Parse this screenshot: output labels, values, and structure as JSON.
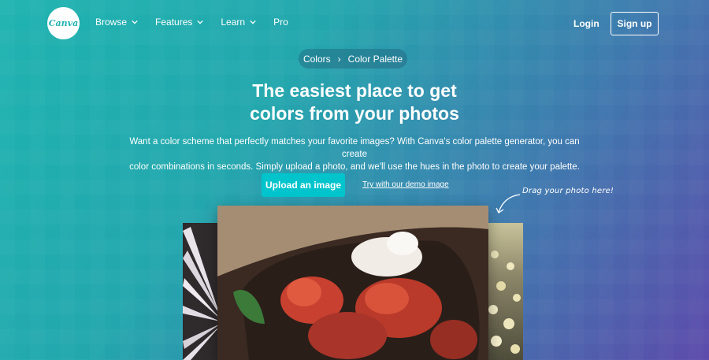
{
  "header": {
    "logo_text": "Canva",
    "nav": [
      {
        "label": "Browse",
        "has_dropdown": true
      },
      {
        "label": "Features",
        "has_dropdown": true
      },
      {
        "label": "Learn",
        "has_dropdown": true
      },
      {
        "label": "Pro",
        "has_dropdown": false
      }
    ],
    "login_label": "Login",
    "signup_label": "Sign up"
  },
  "breadcrumb": {
    "parent": "Colors",
    "current": "Color Palette"
  },
  "hero": {
    "title_line1": "The easiest place to get",
    "title_line2": "colors from your photos",
    "description_line1": "Want a color scheme that perfectly matches your favorite images? With Canva's color palette generator, you can create",
    "description_line2": "color combinations in seconds. Simply upload a photo, and we'll use the hues in the photo to create your palette.",
    "upload_label": "Upload an image",
    "demo_label": "Try with our demo image",
    "drag_hint": "Drag your photo here!"
  },
  "colors": {
    "accent": "#00c4cc",
    "gradient_start": "#1fb3b0",
    "gradient_end": "#5d4bab"
  },
  "images": [
    "daisy-photo",
    "tulips-photo",
    "flowers-field-photo"
  ]
}
